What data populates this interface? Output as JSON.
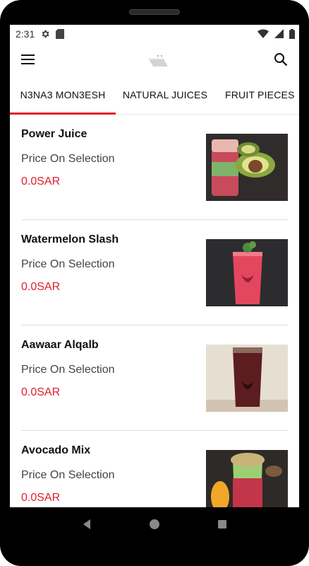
{
  "status": {
    "time": "2:31",
    "icons": [
      "settings-icon",
      "sdcard-icon",
      "wifi-icon",
      "signal-icon",
      "battery-icon"
    ]
  },
  "appbar": {
    "menu_icon": "menu-icon",
    "search_icon": "search-icon",
    "logo": "app-logo"
  },
  "tabs": [
    {
      "label": "N3NA3 MON3ESH",
      "active": true
    },
    {
      "label": "NATURAL JUICES",
      "active": false
    },
    {
      "label": "FRUIT PIECES",
      "active": false
    }
  ],
  "items": [
    {
      "name": "Power Juice",
      "price_label": "Price On Selection",
      "price": "0.0SAR"
    },
    {
      "name": "Watermelon Slash",
      "price_label": "Price On Selection",
      "price": "0.0SAR"
    },
    {
      "name": "Aawaar Alqalb",
      "price_label": "Price On Selection",
      "price": "0.0SAR"
    },
    {
      "name": "Avocado Mix",
      "price_label": "Price On Selection",
      "price": "0.0SAR"
    }
  ],
  "colors": {
    "accent": "#e11d2e",
    "text": "#111111",
    "muted": "#444444"
  }
}
